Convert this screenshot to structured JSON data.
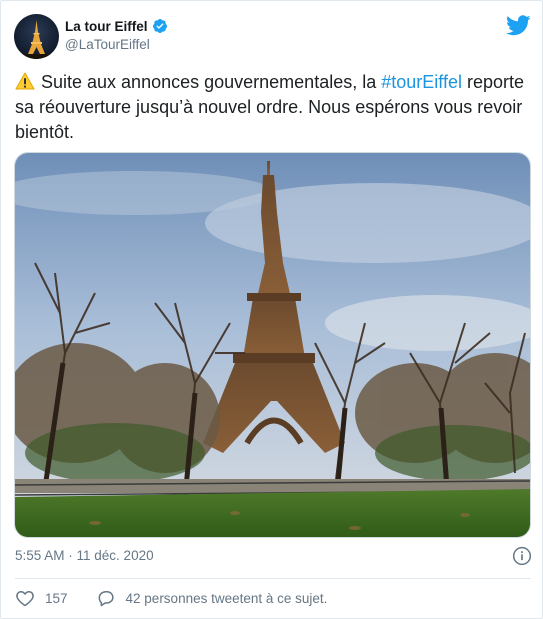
{
  "account": {
    "display_name": "La tour Eiffel",
    "handle": "@LaTourEiffel",
    "verified": true
  },
  "tweet": {
    "text_before": "Suite aux annonces gouvernementales, la ",
    "hashtag": "#tourEiffel",
    "text_after": " reporte sa réouverture jusqu’à nouvel ordre. Nous espérons vous revoir bientôt.",
    "emoji": "warning-emoji",
    "timestamp": "5:55 AM · 11 déc. 2020"
  },
  "engagement": {
    "likes": "157",
    "conversation": "42 personnes tweetent à ce sujet."
  },
  "colors": {
    "brand": "#1da1f2",
    "hashtag": "#1b95e0",
    "muted": "#657786"
  },
  "icons": [
    "verified-icon",
    "twitter-bird-icon",
    "info-icon",
    "heart-icon",
    "comment-icon"
  ]
}
